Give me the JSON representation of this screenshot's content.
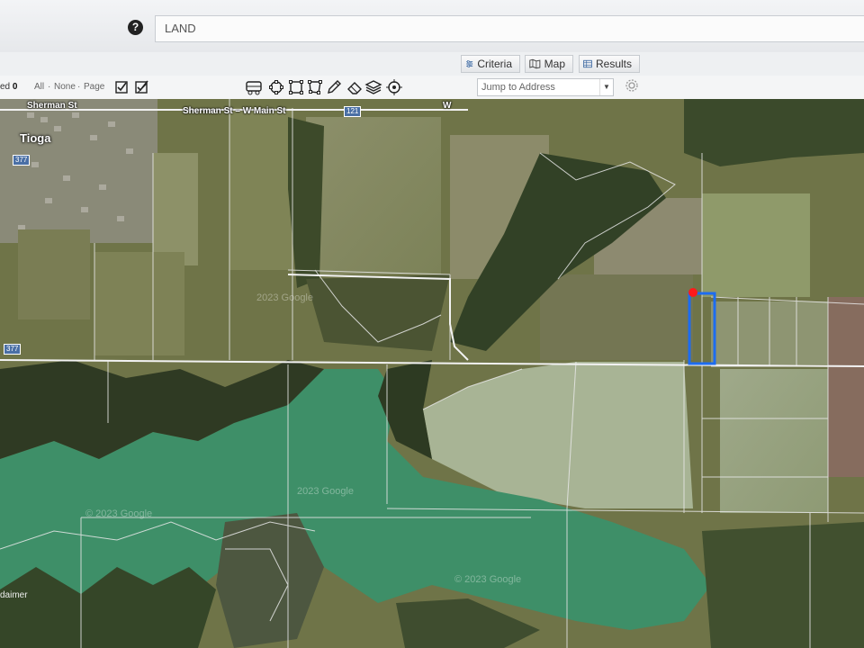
{
  "header": {
    "search_value": "LAND",
    "help_icon": "question-circle-icon"
  },
  "tabs": [
    {
      "label": "Criteria",
      "icon": "sliders-icon"
    },
    {
      "label": "Map",
      "icon": "map-icon"
    },
    {
      "label": "Results",
      "icon": "grid-icon"
    }
  ],
  "toolbar": {
    "selected_prefix": "ed",
    "selected_count": "0",
    "all_label": "All",
    "none_label": "None",
    "page_label": "Page",
    "separator": "·",
    "address_placeholder": "Jump to Address",
    "tools": [
      "bus-icon",
      "circle-draw-icon",
      "square-draw-icon",
      "polygon-draw-icon",
      "pencil-icon",
      "eraser-icon",
      "layers-icon",
      "target-icon"
    ]
  },
  "map": {
    "roads": [
      "Sherman St",
      "Sherman St – W Main St",
      "W"
    ],
    "town": "Tioga",
    "highway_shields": [
      "121",
      "377",
      "377"
    ],
    "watermarks": [
      "2023 Google",
      "© 2023 Google",
      "© 2023 Google",
      "2023 Google"
    ],
    "corner_label": "daimer",
    "highlight_color": "#1d6cf0",
    "marker_color": "#ff1a1a",
    "water_color": "#3e8f68"
  }
}
